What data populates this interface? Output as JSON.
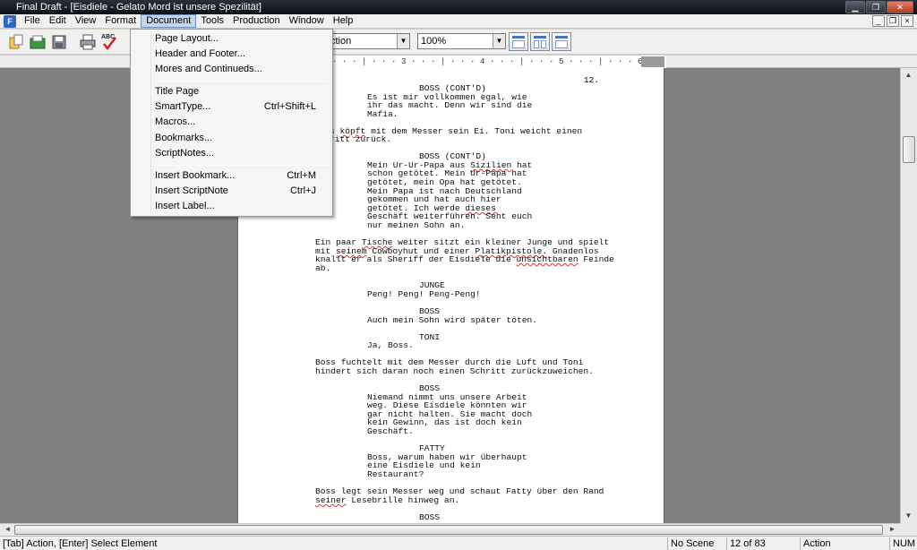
{
  "window": {
    "title": "Final Draft - [Eisdiele - Gelato Mord ist unsere Spezilität]",
    "minimize_glyph": "▁",
    "maximize_glyph": "❐",
    "close_glyph": "✕"
  },
  "menubar": {
    "items": [
      "File",
      "Edit",
      "View",
      "Format",
      "Document",
      "Tools",
      "Production",
      "Window",
      "Help"
    ],
    "active": "Document",
    "mdi_glyphs": [
      "_",
      "❐",
      "×"
    ]
  },
  "toolbar": {
    "element_selector_value": "ction",
    "zoom_value": "100%",
    "combo_arrow_glyph": "▼",
    "icons": [
      "new-document-icon",
      "open-folder-icon",
      "save-icon",
      "print-icon",
      "spellcheck-icon"
    ],
    "spellcheck_label": "ABC"
  },
  "ruler": {
    "scale_text": "2 · · · | · · · 3 · · · | · · · 4 · · · | · · · 5 · · · | · · · 6 · · · | · · · 7 · · · △ · · · 8"
  },
  "document_menu": {
    "items": [
      {
        "label": "Page Layout...",
        "shortcut": ""
      },
      {
        "label": "Header and Footer...",
        "shortcut": ""
      },
      {
        "label": "Mores and Continueds...",
        "shortcut": ""
      },
      {
        "label": "Title Page",
        "shortcut": ""
      },
      {
        "label": "SmartType...",
        "shortcut": "Ctrl+Shift+L"
      },
      {
        "label": "Macros...",
        "shortcut": ""
      },
      {
        "label": "Bookmarks...",
        "shortcut": ""
      },
      {
        "label": "ScriptNotes...",
        "shortcut": ""
      },
      {
        "label": "Insert Bookmark...",
        "shortcut": "Ctrl+M"
      },
      {
        "label": "Insert ScriptNote",
        "shortcut": "Ctrl+J"
      },
      {
        "label": "Insert Label...",
        "shortcut": ""
      }
    ]
  },
  "script": {
    "page_number": "12.",
    "lines": [
      "BOSS (CONT'D)",
      "Es ist mir vollkommen egal, wie",
      "ihr das macht. Denn wir sind die",
      "Mafia.",
      "s köpft mit dem Messer sein Ei. Toni weicht einen",
      "ritt zurück.",
      "BOSS (CONT'D)",
      "Mein Ur-Ur-Papa aus Sizilien hat",
      "schon getötet. Mein Ur-Papa hat",
      "getötet, mein Opa hat getötet.",
      "Mein Papa ist nach Deutschland",
      "gekommen und hat auch hier",
      "getötet. Ich werde dieses",
      "Geschäft weiterführen. Seht euch",
      "nur meinen Sohn an.",
      "Ein paar Tische weiter sitzt ein kleiner Junge und spielt",
      "mit seinem Cowboyhut und einer Platikpistole. Gnadenlos",
      "knallt er als Sheriff der Eisdiele die unsichtbaren Feinde",
      "ab.",
      "JUNGE",
      "Peng! Peng! Peng-Peng!",
      "BOSS",
      "Auch mein Sohn wird später töten.",
      "TONI",
      "Ja, Boss.",
      "Boss fuchtelt mit dem Messer durch die Luft und Toni",
      "hindert sich daran noch einen Schritt zurückzuweichen.",
      "BOSS",
      "Niemand nimmt uns unsere Arbeit",
      "weg. Diese Eisdiele könnten wir",
      "gar nicht halten. Sie macht doch",
      "kein Gewinn, das ist doch kein",
      "Geschäft.",
      "FATTY",
      "Boss, warum haben wir überhaupt",
      "eine Eisdiele und kein",
      "Restaurant?",
      "Boss legt sein Messer weg und schaut Fatty über den Rand",
      "seiner Lesebrille hinweg an.",
      "BOSS"
    ]
  },
  "statusbar": {
    "hint": "[Tab]  Action,  [Enter] Select Element",
    "scene": "No Scene",
    "page": "12 of 83",
    "element": "Action",
    "numlock": "NUM"
  },
  "scroll_glyphs": {
    "up": "▲",
    "down": "▼",
    "left": "◄",
    "right": "►"
  }
}
